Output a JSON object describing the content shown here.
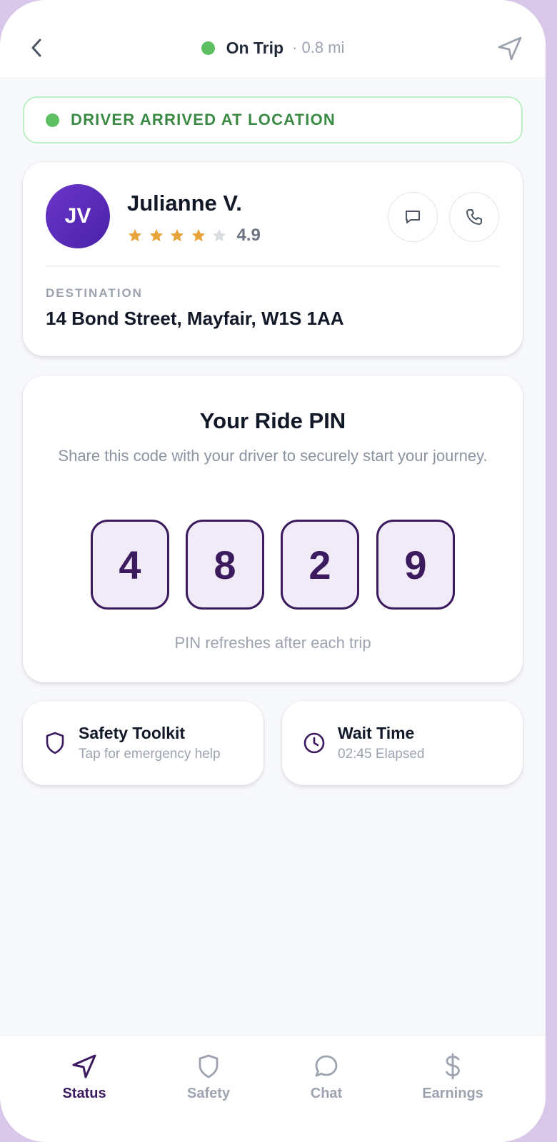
{
  "header": {
    "status_label": "On Trip",
    "distance": "· 0.8 mi",
    "status_color": "#5cc062"
  },
  "banner": {
    "text": "DRIVER ARRIVED AT LOCATION",
    "color": "#3a8a45"
  },
  "driver": {
    "initials": "JV",
    "name": "Julianne V.",
    "rating": "4.9",
    "stars_filled": 4,
    "stars_total": 5,
    "destination_label": "DESTINATION",
    "destination": "14 Bond Street, Mayfair, W1S 1AA",
    "icons": [
      "message-icon",
      "phone-icon"
    ]
  },
  "pin": {
    "title": "Your Ride PIN",
    "subtitle": "Share this code with your driver to securely start your journey.",
    "digits": [
      "4",
      "8",
      "2",
      "9"
    ],
    "note": "PIN refreshes after each trip",
    "accent": "#3b1a5e"
  },
  "safety": {
    "title": "Safety Toolkit",
    "subtitle": "Tap for emergency help",
    "icon": "shield-icon"
  },
  "wait": {
    "title": "Wait Time",
    "subtitle": "02:45 Elapsed",
    "icon": "clock-icon"
  },
  "tabs": [
    {
      "label": "Status",
      "icon": "navigation-icon",
      "active": true
    },
    {
      "label": "Safety",
      "icon": "shield-icon",
      "active": false
    },
    {
      "label": "Chat",
      "icon": "chat-icon",
      "active": false
    },
    {
      "label": "Earnings",
      "icon": "dollar-icon",
      "active": false
    }
  ]
}
